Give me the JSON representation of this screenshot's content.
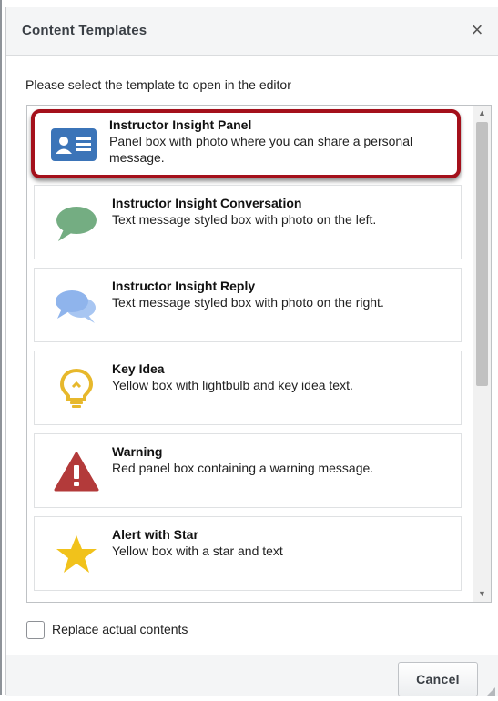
{
  "dialog": {
    "title": "Content Templates",
    "close_label": "×",
    "instruction": "Please select the template to open in the editor",
    "templates": [
      {
        "name": "Instructor Insight Panel",
        "description": "Panel box with photo where you can share a personal message.",
        "icon": "profile-card-icon",
        "selected": true
      },
      {
        "name": "Instructor Insight Conversation",
        "description": "Text message styled box with photo on the left.",
        "icon": "speech-bubble-icon",
        "selected": false
      },
      {
        "name": "Instructor Insight Reply",
        "description": "Text message styled box with photo on the right.",
        "icon": "double-speech-bubble-icon",
        "selected": false
      },
      {
        "name": "Key Idea",
        "description": "Yellow box with lightbulb and key idea text.",
        "icon": "lightbulb-icon",
        "selected": false
      },
      {
        "name": "Warning",
        "description": "Red panel box containing a warning message.",
        "icon": "warning-icon",
        "selected": false
      },
      {
        "name": "Alert with Star",
        "description": "Yellow box with a star and text",
        "icon": "star-icon",
        "selected": false
      }
    ],
    "replace_checkbox_label": "Replace actual contents",
    "replace_checked": false,
    "cancel_label": "Cancel"
  },
  "colors": {
    "selection_border": "#a4101b",
    "card_icon": "#3b74b8",
    "conversation_icon": "#74ad82",
    "reply_icon": "#8fb4ec",
    "lightbulb_icon": "#e7b82c",
    "warning_icon": "#b33a3a",
    "star_icon": "#f1c21b"
  }
}
